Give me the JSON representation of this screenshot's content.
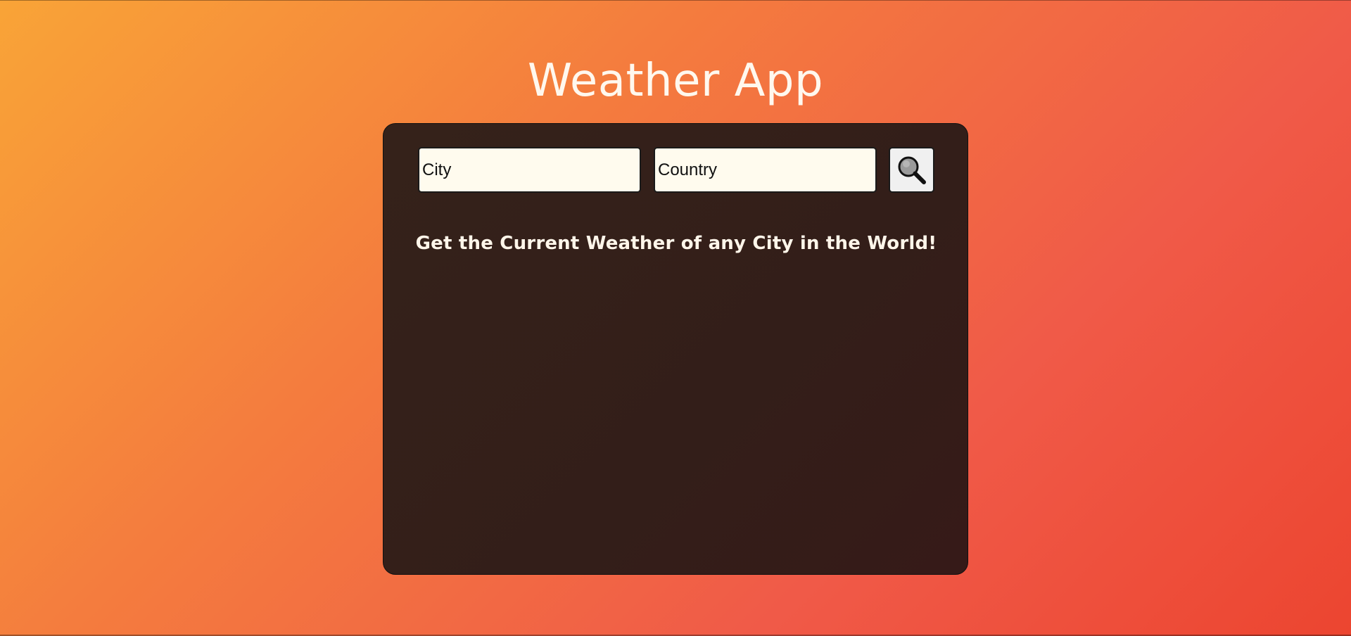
{
  "app": {
    "title": "Weather App"
  },
  "search": {
    "city_placeholder": "City",
    "country_placeholder": "Country",
    "button_icon": "search-icon"
  },
  "main": {
    "tagline": "Get the Current Weather of any City in the World!"
  },
  "colors": {
    "gradient_start": "#f9a437",
    "gradient_end": "#ec4530",
    "card_background": "#35221a",
    "input_background": "#fffbee",
    "text_light": "#fff8ee"
  }
}
